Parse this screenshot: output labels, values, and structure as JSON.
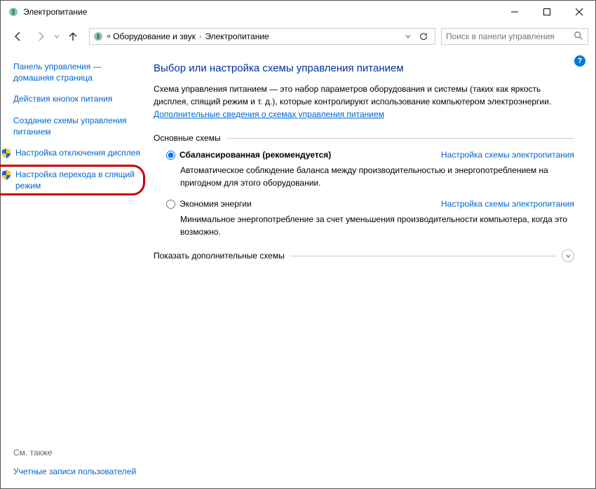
{
  "title": "Электропитание",
  "breadcrumb": {
    "item1": "Оборудование и звук",
    "item2": "Электропитание"
  },
  "search": {
    "placeholder": "Поиск в панели управления"
  },
  "help_badge": "?",
  "sidebar": {
    "home": "Панель управления — домашняя страница",
    "buttons": "Действия кнопок питания",
    "create": "Создание схемы управления питанием",
    "display": "Настройка отключения дисплея",
    "sleep": "Настройка перехода в спящий режим",
    "seealso": "См. также",
    "accounts": "Учетные записи пользователей"
  },
  "main": {
    "title": "Выбор или настройка схемы управления питанием",
    "desc": "Схема управления питанием — это набор параметров оборудования и системы (таких как яркость дисплея, спящий режим и т. д.), которые контролируют использование компьютером электроэнергии. ",
    "desc_link": "Дополнительные сведения о схемах управления питанием",
    "section": "Основные схемы",
    "plan1": {
      "name": "Сбалансированная (рекомендуется)",
      "link": "Настройка схемы электропитания",
      "desc": "Автоматическое соблюдение баланса между производительностью и энергопотреблением на пригодном для этого оборудовании."
    },
    "plan2": {
      "name": "Экономия энергии",
      "link": "Настройка схемы электропитания",
      "desc": "Минимальное энергопотребление за счет уменьшения производительности компьютера, когда это возможно."
    },
    "expand": "Показать дополнительные схемы"
  }
}
